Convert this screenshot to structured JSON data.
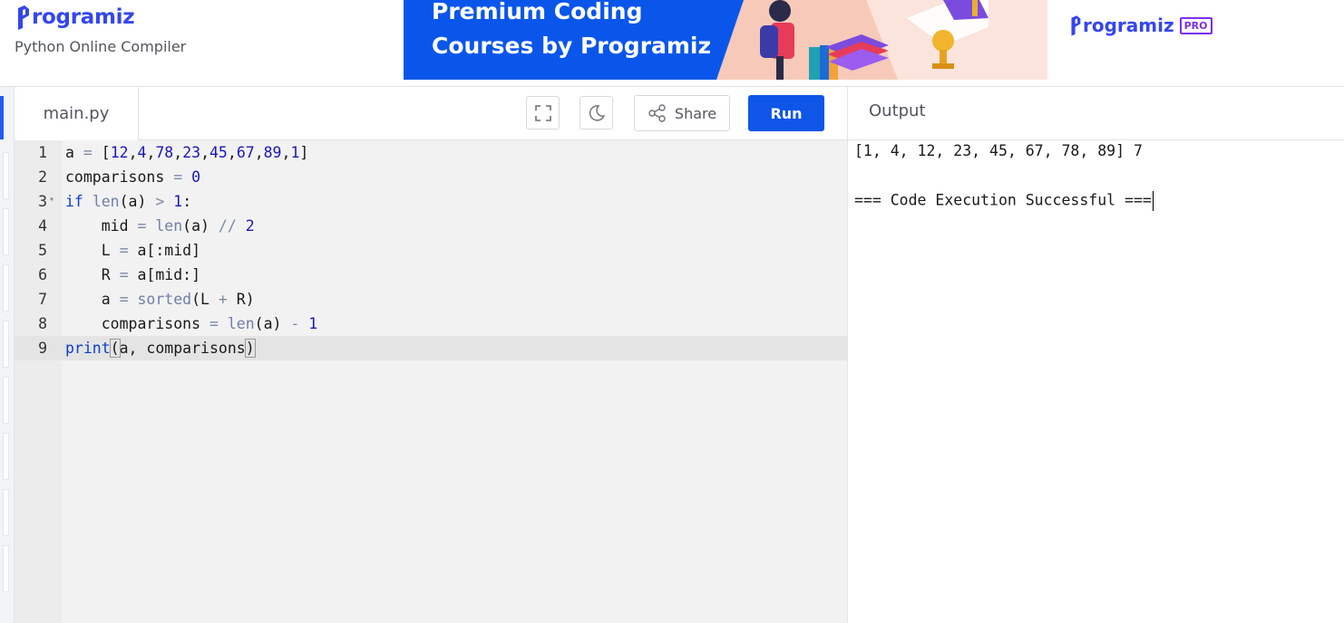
{
  "header": {
    "logo_text": "rogramiz",
    "subtitle": "Python Online Compiler"
  },
  "banner": {
    "line1": "Premium Coding",
    "line2": "Courses by Programiz",
    "pro_logo_text": "rogramiz",
    "pro_badge": "PRO"
  },
  "editor": {
    "tab_label": "main.py",
    "share_label": "Share",
    "run_label": "Run",
    "line_numbers": [
      "1",
      "2",
      "3",
      "4",
      "5",
      "6",
      "7",
      "8",
      "9"
    ]
  },
  "output": {
    "title": "Output",
    "lines": [
      "[1, 4, 12, 23, 45, 67, 78, 89] 7",
      "",
      "=== Code Execution Successful ==="
    ]
  },
  "colors": {
    "brand": "#3446ee",
    "run_button": "#0f56e8",
    "banner_bg": "#0a56ea",
    "pro_badge": "#7a2ff0"
  },
  "icons": [
    "fullscreen-icon",
    "dark-mode-moon-icon",
    "share-icon"
  ]
}
